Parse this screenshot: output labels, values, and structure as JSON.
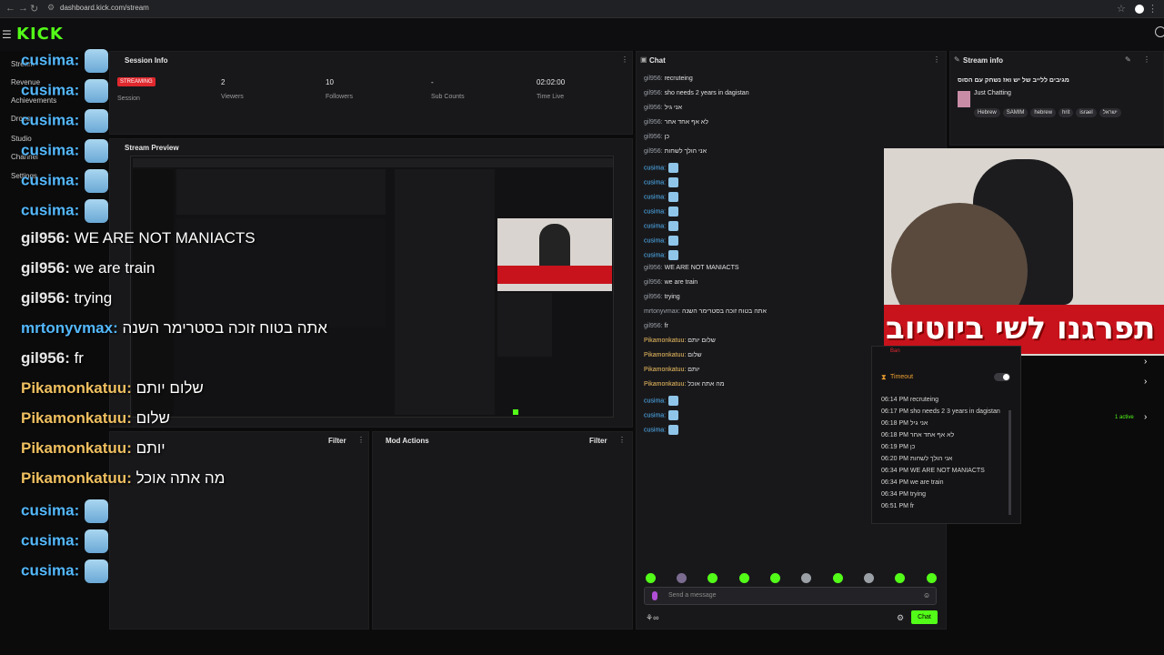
{
  "browser": {
    "url": "dashboard.kick.com/stream"
  },
  "header": {
    "logo": "KICK"
  },
  "sidebar": {
    "items": [
      {
        "label": "Stream"
      },
      {
        "label": "Revenue"
      },
      {
        "label": "Achievements"
      },
      {
        "label": "Drops"
      },
      {
        "label": "Studio"
      },
      {
        "label": "Channel"
      },
      {
        "label": "Settings"
      }
    ]
  },
  "session": {
    "title": "Session Info",
    "status": "STREAMING",
    "status_label": "Session",
    "stats": [
      {
        "value": "2",
        "label": "Viewers"
      },
      {
        "value": "10",
        "label": "Followers"
      },
      {
        "value": "-",
        "label": "Sub Counts"
      },
      {
        "value": "02:02:00",
        "label": "Time Live"
      }
    ]
  },
  "preview": {
    "title": "Stream Preview"
  },
  "bottom_panels": {
    "filter1": "Filter",
    "mod_actions": "Mod Actions",
    "filter2": "Filter"
  },
  "overlay": {
    "lines": [
      {
        "user": "cusima:",
        "text": "",
        "emote": true
      },
      {
        "user": "cusima:",
        "text": "",
        "emote": true
      },
      {
        "user": "cusima:",
        "text": "",
        "emote": true
      },
      {
        "user": "cusima:",
        "text": "",
        "emote": true
      },
      {
        "user": "cusima:",
        "text": "",
        "emote": true
      },
      {
        "user": "cusima:",
        "text": "",
        "emote": true
      },
      {
        "user": "gil956:",
        "text": "WE ARE NOT MANIACTS",
        "emote": false
      },
      {
        "user": "gil956:",
        "text": "we are train",
        "emote": false
      },
      {
        "user": "gil956:",
        "text": "trying",
        "emote": false
      },
      {
        "user": "mrtonyvmax:",
        "text": "אתה בטוח זוכה בסטרימר השנה",
        "emote": false
      },
      {
        "user": "gil956:",
        "text": "fr",
        "emote": false
      },
      {
        "user": "Pikamonkatuu:",
        "text": "שלום יותם",
        "emote": false
      },
      {
        "user": "Pikamonkatuu:",
        "text": "שלום",
        "emote": false
      },
      {
        "user": "Pikamonkatuu:",
        "text": "יותם",
        "emote": false
      },
      {
        "user": "Pikamonkatuu:",
        "text": "מה אתה אוכל",
        "emote": false
      },
      {
        "user": "cusima:",
        "text": "",
        "emote": true
      },
      {
        "user": "cusima:",
        "text": "",
        "emote": true
      },
      {
        "user": "cusima:",
        "text": "",
        "emote": true
      }
    ]
  },
  "chat": {
    "title": "Chat",
    "messages": [
      {
        "user": "gil956:",
        "text": "recruteing"
      },
      {
        "user": "gil956:",
        "text": "sho needs 2 years in dagistan"
      },
      {
        "user": "gil956:",
        "text": "אני גיל"
      },
      {
        "user": "gil956:",
        "text": "לא אף אחד אחר"
      },
      {
        "user": "gil956:",
        "text": "כן"
      },
      {
        "user": "gil956:",
        "text": "אני הולך לשחות"
      },
      {
        "user": "cusima:",
        "text": ""
      },
      {
        "user": "cusima:",
        "text": ""
      },
      {
        "user": "cusima:",
        "text": ""
      },
      {
        "user": "cusima:",
        "text": ""
      },
      {
        "user": "cusima:",
        "text": ""
      },
      {
        "user": "cusima:",
        "text": ""
      },
      {
        "user": "cusima:",
        "text": ""
      },
      {
        "user": "gil956:",
        "text": "WE ARE NOT MANIACTS"
      },
      {
        "user": "gil956:",
        "text": "we are train"
      },
      {
        "user": "gil956:",
        "text": "trying"
      },
      {
        "user": "mrtonyvmax:",
        "text": "אתה בטוח זוכה בסטרימר השנה"
      },
      {
        "user": "gil956:",
        "text": "fr"
      },
      {
        "user": "Pikamonkatuu:",
        "text": "שלום יותם"
      },
      {
        "user": "Pikamonkatuu:",
        "text": "שלום"
      },
      {
        "user": "Pikamonkatuu:",
        "text": "יותם"
      },
      {
        "user": "Pikamonkatuu:",
        "text": "מה אתה אוכל"
      },
      {
        "user": "cusima:",
        "text": ""
      },
      {
        "user": "cusima:",
        "text": ""
      },
      {
        "user": "cusima:",
        "text": ""
      }
    ],
    "input_placeholder": "Send a message",
    "send_label": "Chat"
  },
  "stream_info": {
    "title": "Stream info",
    "stream_title": "מגיבים ללייב של יש ואז נשחק עם הסוס",
    "category": "Just Chatting",
    "tags": [
      "Hebrew",
      "SAMIM",
      "hebrew",
      "hrit",
      "israel",
      "ישראל"
    ]
  },
  "overlay_banner": {
    "text": "תפרגנו לשי ביוטיוב"
  },
  "mod_popup": {
    "ban": "Ban",
    "timeout": "Timeout",
    "active": "1 active",
    "log": [
      {
        "time": "06:14 PM",
        "text": "recruteing"
      },
      {
        "time": "06:17 PM",
        "text": "sho needs 2 3 years in dagistan"
      },
      {
        "time": "06:18 PM",
        "text": "אני גיל"
      },
      {
        "time": "06:18 PM",
        "text": "לא אף אחד אחר"
      },
      {
        "time": "06:19 PM",
        "text": "כן"
      },
      {
        "time": "06:20 PM",
        "text": "אני הולך לשחות"
      },
      {
        "time": "06:34 PM",
        "text": "WE ARE NOT MANIACTS"
      },
      {
        "time": "06:34 PM",
        "text": "we are train"
      },
      {
        "time": "06:34 PM",
        "text": "trying"
      },
      {
        "time": "06:51 PM",
        "text": "fr"
      }
    ]
  },
  "colors": {
    "accent": "#53fc18",
    "streaming": "#e0292e",
    "user_cusima": "#53b8fc",
    "user_pika": "#f0c060"
  }
}
